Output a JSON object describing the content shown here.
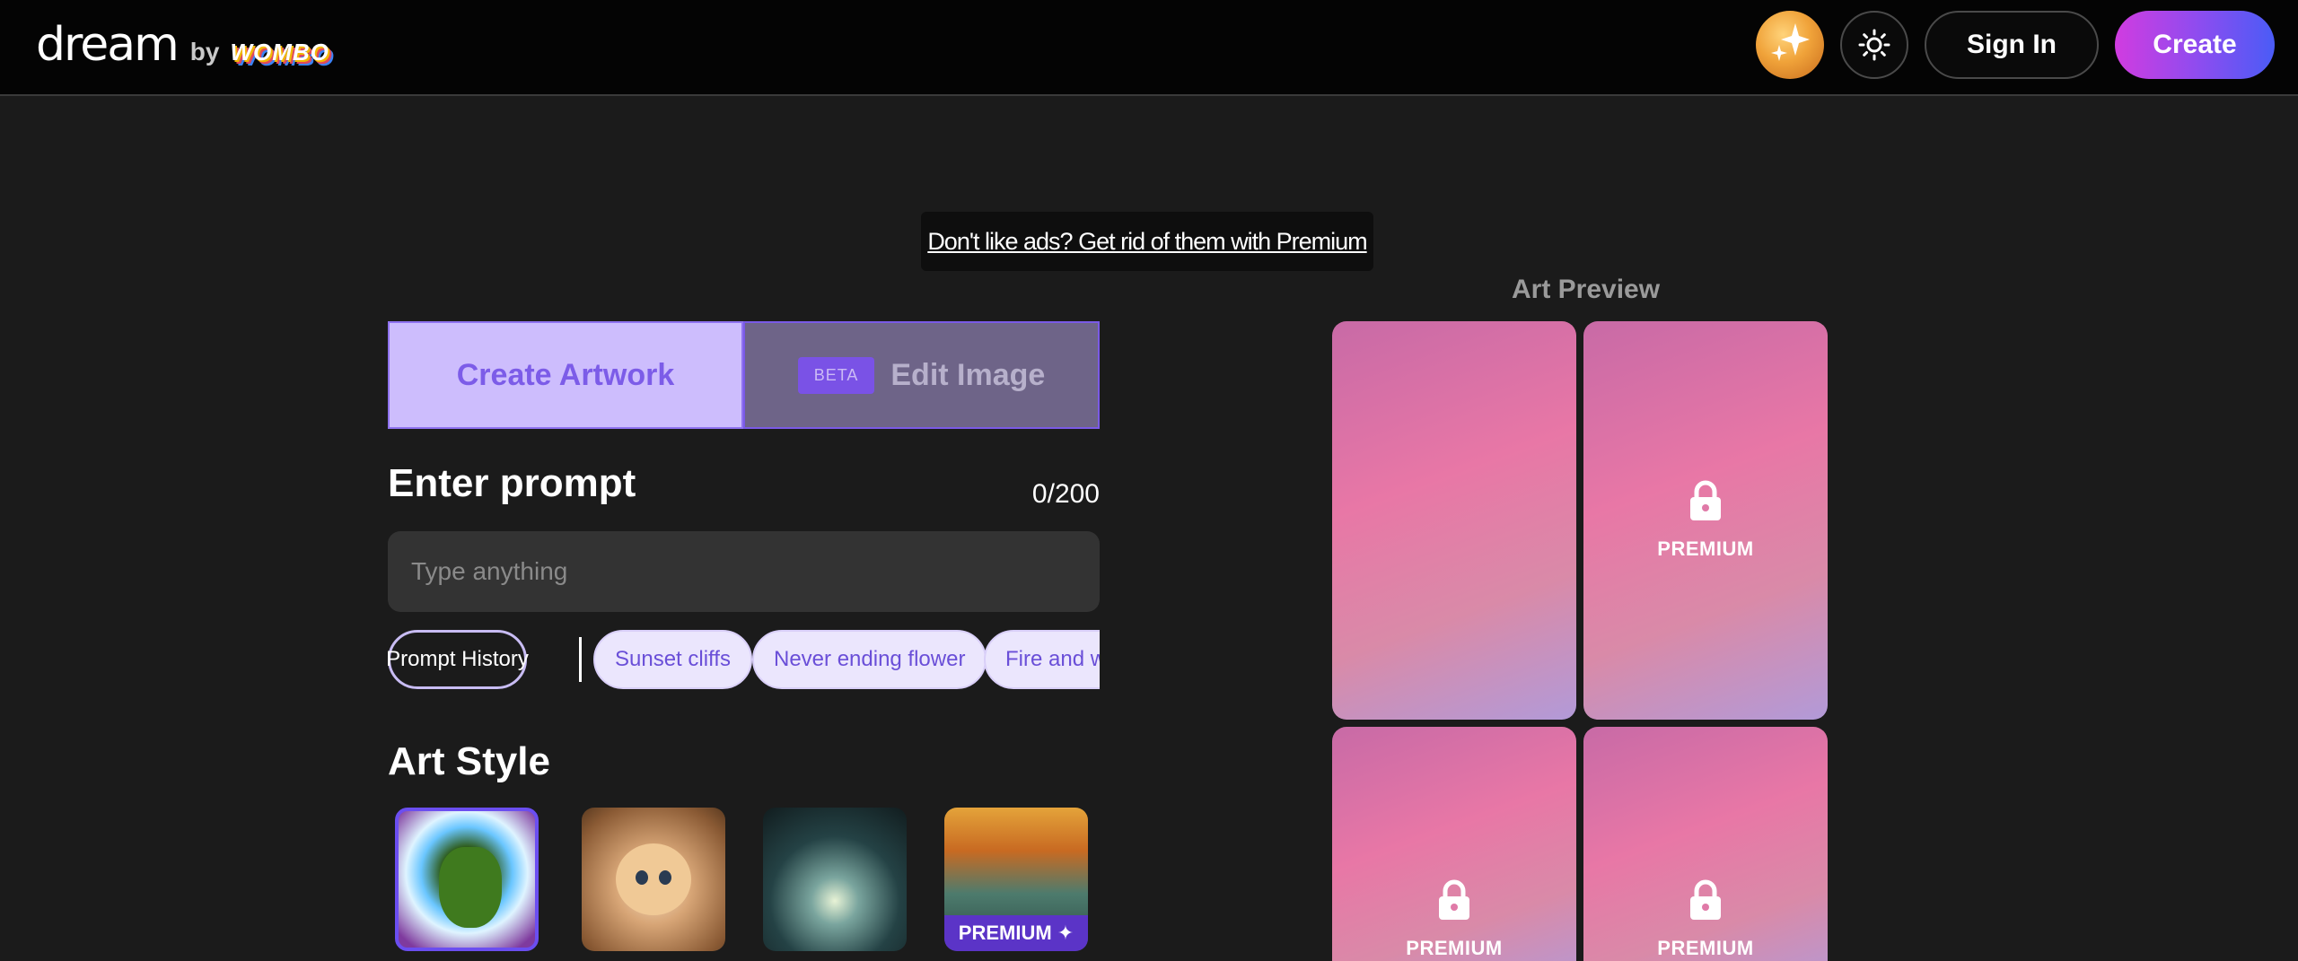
{
  "header": {
    "logo_text": "dream",
    "logo_by": "by",
    "logo_brand": "WOMBO",
    "signin_label": "Sign In",
    "create_label": "Create"
  },
  "ad_notice": "Don't like ads? Get rid of them with Premium",
  "tabs": {
    "create_label": "Create Artwork",
    "edit_badge": "BETA",
    "edit_label": "Edit Image"
  },
  "prompt": {
    "title": "Enter prompt",
    "counter": "0/200",
    "placeholder": "Type anything",
    "history_label": "Prompt History",
    "suggestions": [
      "Sunset cliffs",
      "Never ending flower",
      "Fire and w"
    ]
  },
  "art_style": {
    "title": "Art Style",
    "premium_tag": "PREMIUM ✦"
  },
  "preview": {
    "title": "Art Preview",
    "premium_label": "PREMIUM"
  },
  "colors": {
    "accent": "#7c5ce8",
    "create_gradient_start": "#d13ce0",
    "create_gradient_end": "#4a5cf6",
    "premium_tag": "#5b34c7"
  }
}
